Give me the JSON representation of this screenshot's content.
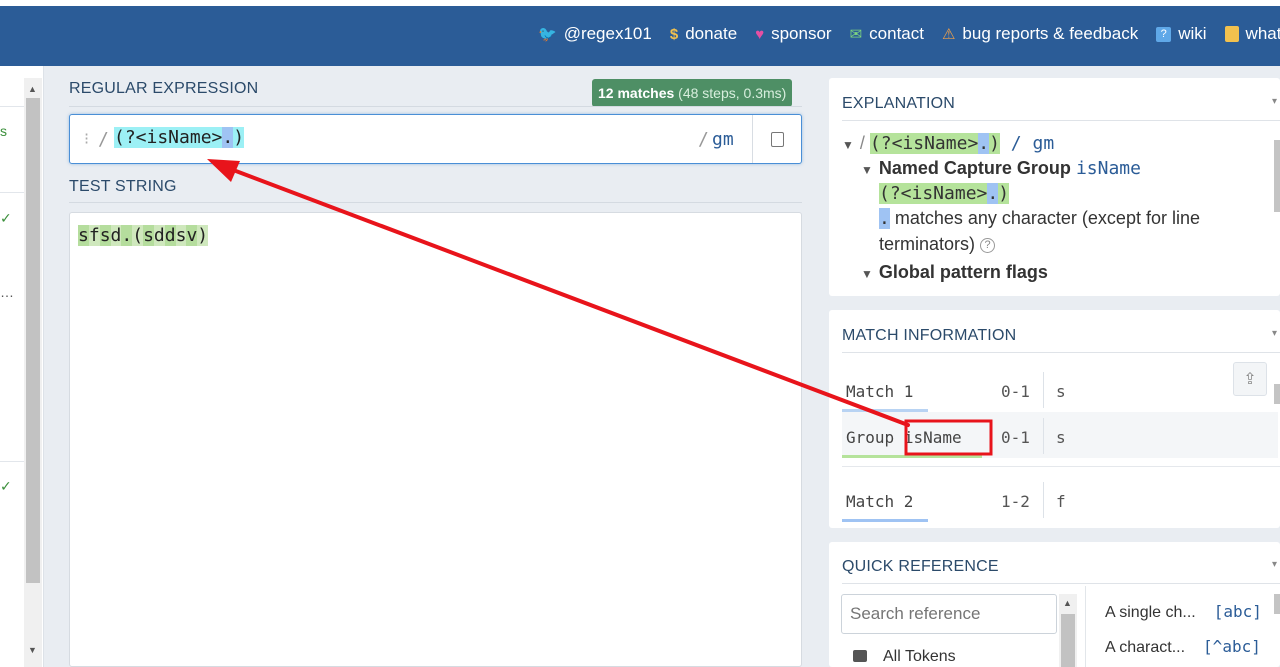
{
  "nav": [
    {
      "icon": "twitter-icon",
      "glyph": "🐦",
      "label": "@regex101"
    },
    {
      "icon": "dollar-icon",
      "glyph": "$",
      "label": "donate"
    },
    {
      "icon": "heart-icon",
      "glyph": "♥",
      "label": "sponsor"
    },
    {
      "icon": "mail-icon",
      "glyph": "✉",
      "label": "contact"
    },
    {
      "icon": "warning-icon",
      "glyph": "⚠",
      "label": "bug reports & feedback"
    },
    {
      "icon": "help-icon",
      "glyph": "❓",
      "label": "wiki"
    },
    {
      "icon": "news-icon",
      "glyph": "▦",
      "label": "whats new"
    }
  ],
  "sidebar": {
    "t1": "s",
    "t2": "✓",
    "t3": "…",
    "t4": "✓"
  },
  "regex": {
    "section_title": "REGULAR EXPRESSION",
    "badge_main": "12 matches",
    "badge_sub": " (48 steps, 0.3ms)",
    "drag_handle": "⁝",
    "open_delim": "/",
    "group_part": "(?<isName>",
    "dot_part": ".",
    "close_part": ")",
    "close_delim": "/",
    "flags": "gm"
  },
  "test": {
    "section_title": "TEST STRING",
    "chars": [
      "s",
      "f",
      "s",
      "d",
      ".",
      "(",
      "s",
      "d",
      "d",
      "s",
      "v",
      ")"
    ]
  },
  "explanation": {
    "title": "EXPLANATION",
    "root_prefix": "/ ",
    "root_group": "(?<isName>",
    "root_dot": ".",
    "root_close": ")",
    "root_suffix": " / gm",
    "named_group_label": "Named Capture Group",
    "named_group_name": "isName",
    "sub_group": "(?<isName>",
    "sub_dot": ".",
    "sub_close": ")",
    "dot_token": ".",
    "dot_desc_1": " matches any character (except for line",
    "dot_desc_2": "terminators)",
    "help": "?",
    "flags_label": "Global pattern flags"
  },
  "match_info": {
    "title": "MATCH INFORMATION",
    "rows": [
      {
        "label": "Match 1",
        "range": "0-1",
        "value": "s"
      },
      {
        "label_a": "Group",
        "label_b": "isName",
        "range": "0-1",
        "value": "s"
      },
      {
        "label": "Match 2",
        "range": "1-2",
        "value": "f"
      }
    ]
  },
  "quick_ref": {
    "title": "QUICK REFERENCE",
    "search_placeholder": "Search reference",
    "category": "All Tokens",
    "items": [
      {
        "desc": "A single ch...",
        "token": "[abc]"
      },
      {
        "desc": "A charact...",
        "token": "[^abc]"
      }
    ]
  },
  "colors": {
    "header": "#2b5c97",
    "match_badge": "#4e8f65",
    "group_highlight": "#9cf0f5",
    "dot_highlight": "#9fc3f3",
    "annotation": "#e8141b"
  }
}
